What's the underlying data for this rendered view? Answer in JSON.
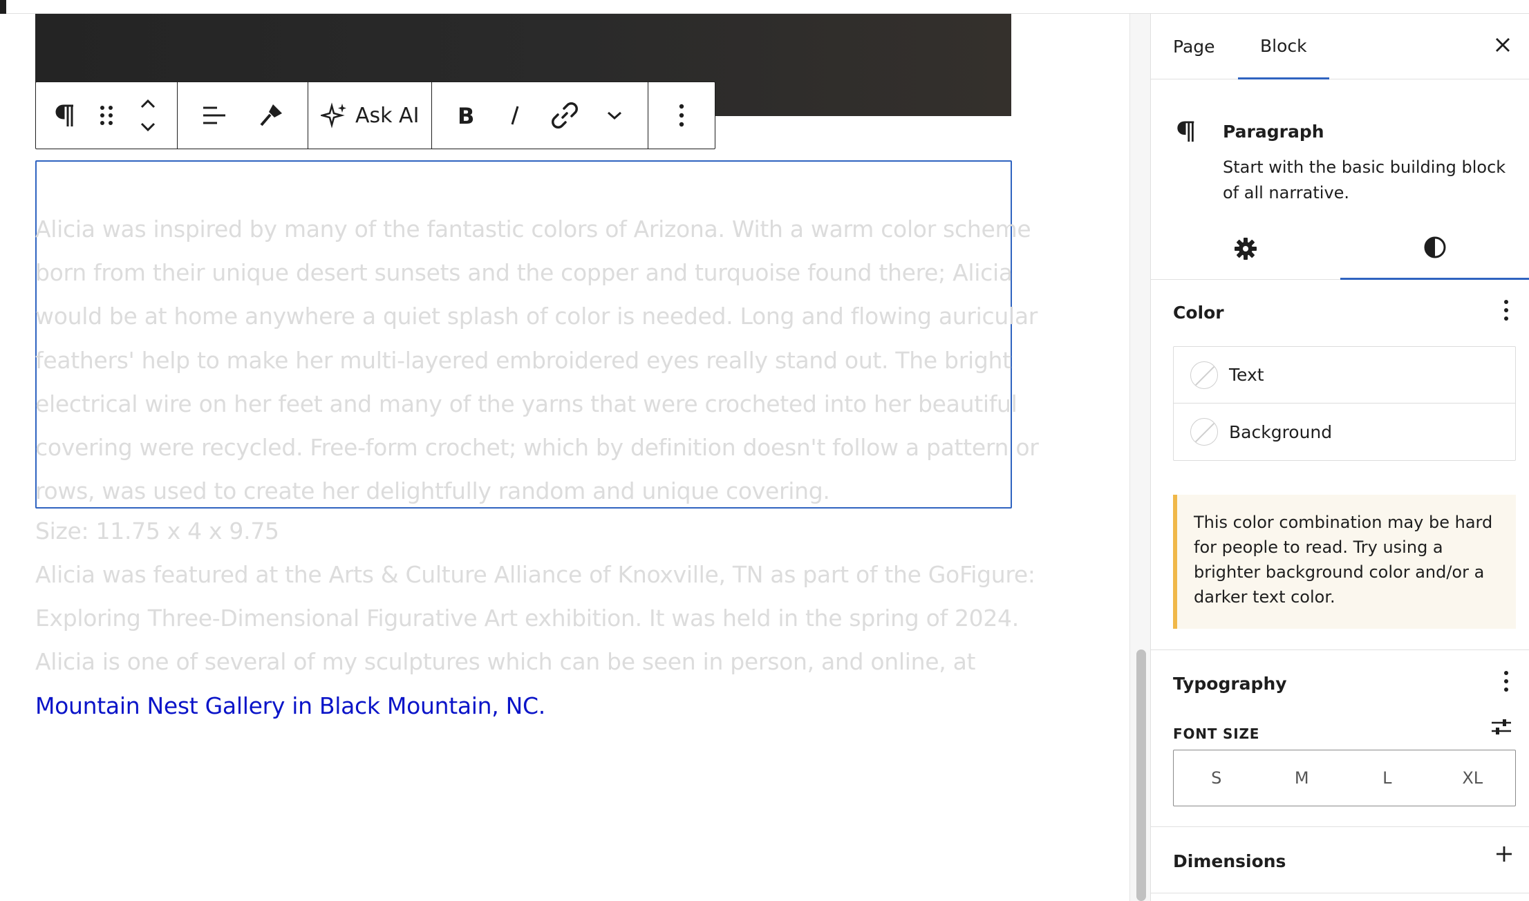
{
  "toolbar": {
    "paragraph_icon": "pilcrow-icon",
    "ask_ai_label": "Ask AI"
  },
  "content": {
    "paragraph_lines": [
      "Alicia was inspired by many of the fantastic colors of Arizona. With a warm color scheme",
      "born from their unique desert sunsets and the copper and turquoise found there; Alicia",
      "would be at home anywhere a quiet splash of color is needed. Long and flowing auricular",
      "feathers' help to make her multi-layered embroidered eyes really stand out. The bright",
      "electrical wire on her feet and many of the yarns that were crocheted into her beautiful",
      "covering were recycled. Free-form crochet; which by definition doesn't follow a pattern or",
      "rows, was used to create her delightfully random and unique covering."
    ],
    "size_line": "Size: 11.75 x 4 x 9.75",
    "featured_line_1": "Alicia was featured at the Arts & Culture Alliance of Knoxville, TN as part of the GoFigure:",
    "featured_line_2": "Exploring Three-Dimensional Figurative Art exhibition. It was held in the spring of 2024.",
    "seen_line": "Alicia is one of several of my sculptures which can be seen in person, and online, at",
    "gallery_link": "Mountain Nest Gallery in Black Mountain, NC."
  },
  "sidebar": {
    "tabs": {
      "page": "Page",
      "block": "Block"
    },
    "block_card": {
      "title": "Paragraph",
      "description": "Start with the basic building block of all narrative."
    },
    "color": {
      "heading": "Color",
      "items": {
        "text": "Text",
        "background": "Background"
      },
      "notice": "This color combination may be hard for people to read. Try using a brighter background color and/or a darker text color."
    },
    "typography": {
      "heading": "Typography",
      "font_size_label": "FONT SIZE",
      "sizes": {
        "s": "S",
        "m": "M",
        "l": "L",
        "xl": "XL"
      }
    },
    "dimensions": {
      "heading": "Dimensions"
    }
  },
  "colors": {
    "accent": "#2f63c0",
    "link": "#0a14c8",
    "muted_text": "#dcdcdc",
    "notice_border": "#f0b849",
    "notice_bg": "#fbf7ee"
  }
}
